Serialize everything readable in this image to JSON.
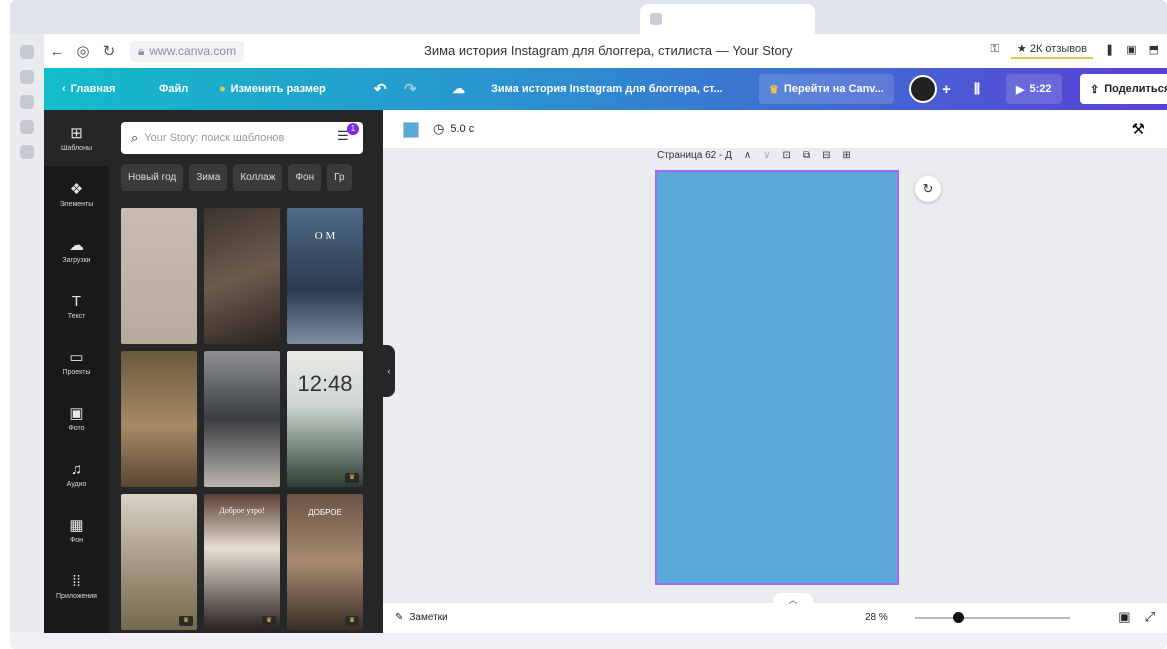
{
  "browser": {
    "address": {
      "url": "www.canva.com",
      "page_title": "Зима история Instagram для блоггера, стилиста — Your Story",
      "reviews": "★ 2К отзывов"
    }
  },
  "topbar": {
    "home": "Главная",
    "file": "Файл",
    "resize": "Изменить размер",
    "doc_title": "Зима история Instagram для блоггера, ст...",
    "canva_pro": "Перейти на Canv...",
    "play_time": "5:22",
    "share": "Поделиться"
  },
  "sidebar": {
    "items": [
      {
        "icon": "⊞",
        "label": "Шаблоны"
      },
      {
        "icon": "❖",
        "label": "Элементы"
      },
      {
        "icon": "☁",
        "label": "Загрузки"
      },
      {
        "icon": "T",
        "label": "Текст"
      },
      {
        "icon": "▭",
        "label": "Проекты"
      },
      {
        "icon": "▣",
        "label": "Фото"
      },
      {
        "icon": "♫",
        "label": "Аудио"
      },
      {
        "icon": "▦",
        "label": "Фон"
      },
      {
        "icon": "⁞⁞",
        "label": "Приложения"
      }
    ]
  },
  "templates": {
    "search_placeholder": "Your Story: поиск шаблонов",
    "filter_count": "1",
    "chips": [
      "Новый год",
      "Зима",
      "Коллаж",
      "Фон",
      "Гр"
    ],
    "thumb_clock": "12:48",
    "thumb_om": "O M",
    "thumb_dobroe": "Доброе утро!",
    "thumb_dobroe2": "ДОБРОЕ"
  },
  "editor": {
    "swatch_color": "#5aa9d8",
    "duration": "5.0 с",
    "page_label": "Страница 62 - Д",
    "notes": "Заметки",
    "zoom": "28 %",
    "zoom_fraction": 0.28
  }
}
